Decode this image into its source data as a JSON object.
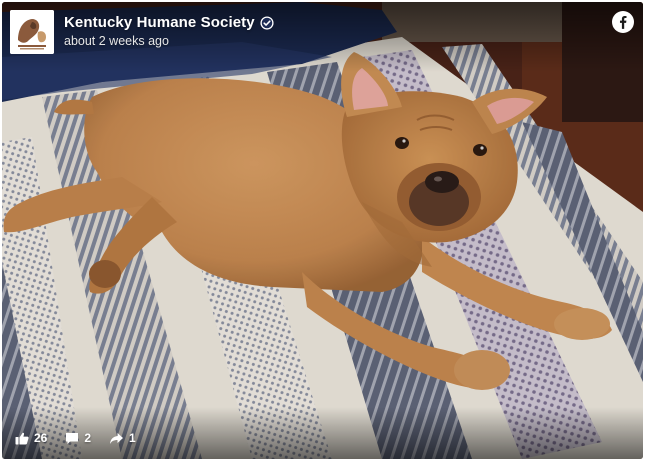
{
  "post": {
    "author": "Kentucky Humane Society",
    "timestamp": "about 2 weeks ago",
    "verified": true,
    "platform_icon": "facebook-icon",
    "photo_alt": "Tan pit bull mix lying on a striped bedspread"
  },
  "stats": {
    "likes": "26",
    "comments": "2",
    "shares": "1"
  },
  "icons": {
    "like": "thumbs-up-icon",
    "comment": "comment-icon",
    "share": "share-arrow-icon"
  },
  "colors": {
    "facebook_blue": "#1877f2",
    "dog_fur": "#c88e57",
    "pillow": "#1f2f57",
    "floor": "#5a2a18"
  }
}
